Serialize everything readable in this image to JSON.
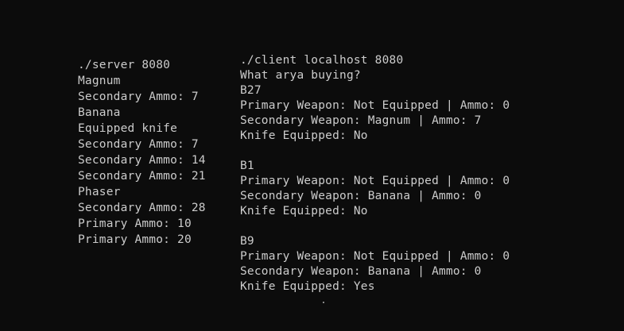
{
  "server_terminal": {
    "lines": [
      "./server 8080",
      "Magnum",
      "Secondary Ammo: 7",
      "Banana",
      "Equipped knife",
      "Secondary Ammo: 7",
      "Secondary Ammo: 14",
      "Secondary Ammo: 21",
      "Phaser",
      "Secondary Ammo: 28",
      "Primary Ammo: 10",
      "Primary Ammo: 20"
    ]
  },
  "client_terminal": {
    "command": "./client localhost 8080",
    "prompt": "What arya buying?",
    "purchases": [
      {
        "code": "B27",
        "primary": "Primary Weapon: Not Equipped | Ammo: 0",
        "secondary": "Secondary Weapon: Magnum | Ammo: 7",
        "knife": "Knife Equipped: No"
      },
      {
        "code": "B1",
        "primary": "Primary Weapon: Not Equipped | Ammo: 0",
        "secondary": "Secondary Weapon: Banana | Ammo: 0",
        "knife": "Knife Equipped: No"
      },
      {
        "code": "B9",
        "primary": "Primary Weapon: Not Equipped | Ammo: 0",
        "secondary": "Secondary Weapon: Banana | Ammo: 0",
        "knife": "Knife Equipped: Yes"
      }
    ]
  },
  "colors": {
    "background": "#0c0c0c",
    "text": "#cccccc"
  }
}
